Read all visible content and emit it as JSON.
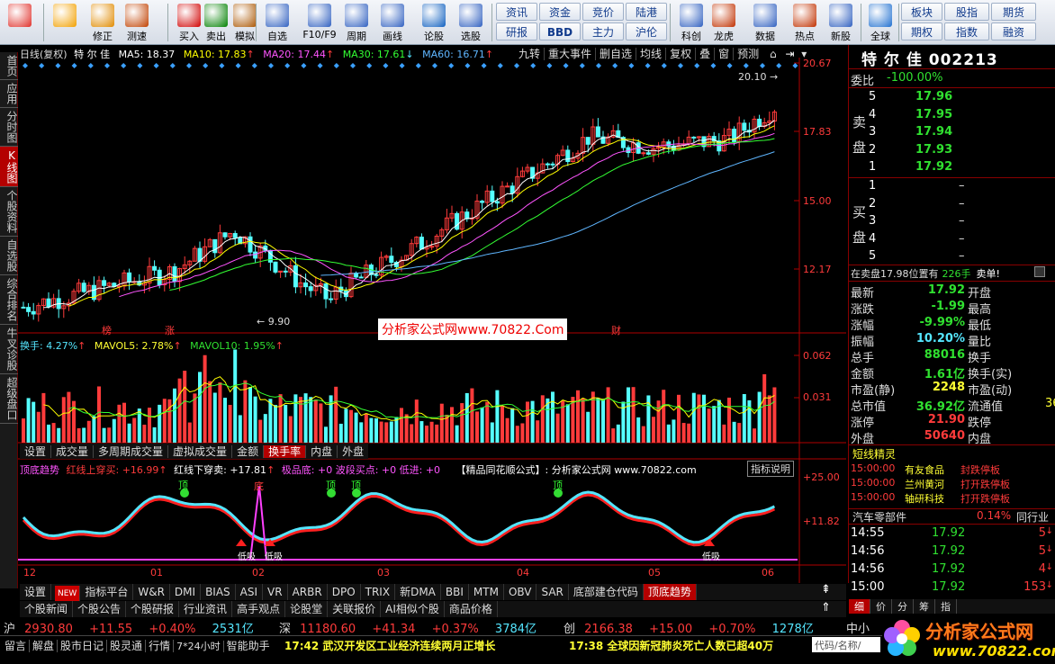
{
  "toolbar": {
    "buttons": [
      {
        "label": "",
        "icon": "grid-icon",
        "color": "#e0302a"
      },
      {
        "label": "",
        "icon": "back-arrow-icon",
        "color": "#f2a000"
      },
      {
        "label": "修正",
        "icon": "repair-icon",
        "color": "#e08a00"
      },
      {
        "label": "测速",
        "icon": "clock-icon",
        "color": "#c04000"
      },
      {
        "label": "买入",
        "icon": "buy-icon",
        "color": "#d00000"
      },
      {
        "label": "卖出",
        "icon": "sell-icon",
        "color": "#008000"
      },
      {
        "label": "模拟",
        "icon": "hammer-icon",
        "color": "#aa5500"
      },
      {
        "label": "自选",
        "icon": "star-icon",
        "color": "#3060c0"
      },
      {
        "label": "F10/F9",
        "icon": "f10-icon",
        "color": "#3060c0"
      },
      {
        "label": "周期",
        "icon": "period-icon",
        "color": "#3060c0"
      },
      {
        "label": "画线",
        "icon": "pen-icon",
        "color": "#3060c0"
      },
      {
        "label": "论股",
        "icon": "discuss-icon",
        "color": "#1060c0"
      },
      {
        "label": "选股",
        "icon": "pick-icon",
        "color": "#3060c0"
      },
      {
        "label": "科创",
        "icon": "sci-icon",
        "color": "#3060c0"
      },
      {
        "label": "龙虎",
        "icon": "dragon-icon",
        "color": "#c03000"
      },
      {
        "label": "数据",
        "icon": "data-icon",
        "color": "#3060c0"
      },
      {
        "label": "热点",
        "icon": "hot-icon",
        "color": "#c03000"
      },
      {
        "label": "新股",
        "icon": "ipo-icon",
        "color": "#3060c0"
      },
      {
        "label": "全球",
        "icon": "globe-icon",
        "color": "#2070d0"
      }
    ],
    "text_buttons": [
      "资讯",
      "资金",
      "竞价",
      "陆港",
      "研报",
      "BBD",
      "主力",
      "沪伦",
      "板块",
      "股指",
      "指数",
      "期货",
      "期权",
      "融资"
    ]
  },
  "left_tabs": [
    "首页",
    "应用",
    "分时图",
    "K线图",
    "个股资料",
    "自选股",
    "综合排名",
    "牛叉诊股",
    "超级盘口"
  ],
  "chart_header": {
    "period": "日线(复权)",
    "name": "特 尔 佳",
    "ma5": "MA5: 18.37",
    "ma10": "MA10: 17.83",
    "ma20": "MA20: 17.44",
    "ma30": "MA30: 17.61",
    "ma60": "MA60: 16.71",
    "buttons": [
      "九转",
      "重大事件",
      "删自选",
      "均线",
      "复权",
      "叠",
      "窗",
      "预测"
    ]
  },
  "price_axis": [
    "20.67",
    "17.83",
    "15.00",
    "12.17"
  ],
  "annotations": {
    "high": "20.10",
    "low": "9.90",
    "markers": [
      "榜",
      "涨",
      "财"
    ]
  },
  "watermark": "分析家公式网www.70822.Com",
  "vol_header": {
    "turnover": "换手: 4.27%",
    "mavol5": "MAVOL5: 2.78%",
    "mavol10": "MAVOL10: 1.95%"
  },
  "vol_axis": [
    "0.062",
    "0.031"
  ],
  "mid_tabs": [
    "设置",
    "成交量",
    "多周期成交量",
    "虚拟成交量",
    "金额",
    "换手率",
    "内盘",
    "外盘"
  ],
  "ind_header": {
    "name": "顶底趋势",
    "red": "红线上穿买: +16.99",
    "green": "红线下穿卖: +17.81",
    "bottom": "极品底: +0",
    "wave": "波段买点: +0",
    "low": "低进: +0",
    "source": "【精品同花顺公式】: 分析家公式网 www.70822.com",
    "explain": "指标说明",
    "labels": [
      "顶",
      "顶",
      "顶",
      "顶",
      "底",
      "低吸",
      "低吸",
      "低吸"
    ]
  },
  "ind_axis": [
    "+25.00",
    "+11.82"
  ],
  "x_axis": [
    "12",
    "01",
    "02",
    "03",
    "04",
    "05",
    "06"
  ],
  "bottom_tabs": [
    "设置",
    "指标平台",
    "W&R",
    "DMI",
    "BIAS",
    "ASI",
    "VR",
    "ARBR",
    "DPO",
    "TRIX",
    "新DMA",
    "BBI",
    "MTM",
    "OBV",
    "SAR",
    "底部建仓代码",
    "顶底趋势"
  ],
  "new_badge": "NEW",
  "bottom_tabs2": [
    "个股新闻",
    "个股公告",
    "个股研报",
    "行业资讯",
    "高手观点",
    "论股堂",
    "关联报价",
    "AI相似个股",
    "商品价格"
  ],
  "quote": {
    "title": "特 尔 佳 002213",
    "weibi_label": "委比",
    "weibi": "-100.00%",
    "sell_label": [
      "卖",
      "盘"
    ],
    "buy_label": [
      "买",
      "盘"
    ],
    "sell": [
      {
        "n": "5",
        "p": "17.96"
      },
      {
        "n": "4",
        "p": "17.95"
      },
      {
        "n": "3",
        "p": "17.94"
      },
      {
        "n": "2",
        "p": "17.93"
      },
      {
        "n": "1",
        "p": "17.92"
      }
    ],
    "buy": [
      {
        "n": "1",
        "p": "–"
      },
      {
        "n": "2",
        "p": "–"
      },
      {
        "n": "3",
        "p": "–"
      },
      {
        "n": "4",
        "p": "–"
      },
      {
        "n": "5",
        "p": "–"
      }
    ],
    "zaimai": "在卖盘17.98位置有",
    "zaimai_vol": "226手",
    "zaimai_tag": "卖单!",
    "stats": [
      {
        "k": "最新",
        "v": "17.92",
        "k2": "开盘",
        "v2": ""
      },
      {
        "k": "涨跌",
        "v": "-1.99",
        "k2": "最高",
        "v2": ""
      },
      {
        "k": "涨幅",
        "v": "-9.99%",
        "k2": "最低",
        "v2": ""
      },
      {
        "k": "振幅",
        "v": "10.20%",
        "k2": "量比",
        "v2": ""
      },
      {
        "k": "总手",
        "v": "88016",
        "k2": "换手",
        "v2": ""
      },
      {
        "k": "金额",
        "v": "1.61亿",
        "k2": "换手(实)",
        "v2": ""
      },
      {
        "k": "市盈(静)",
        "v": "2248",
        "k2": "市盈(动)",
        "v2": ""
      },
      {
        "k": "总市值",
        "v": "36.92亿",
        "k2": "流通值",
        "v2": "36"
      },
      {
        "k": "涨停",
        "v": "21.90",
        "k2": "跌停",
        "v2": ""
      },
      {
        "k": "外盘",
        "v": "50640",
        "k2": "内盘",
        "v2": ""
      }
    ],
    "sprite_title": "短线精灵",
    "sprites": [
      {
        "t": "15:00:00",
        "name": "有友食品",
        "act": "封跌停板"
      },
      {
        "t": "15:00:00",
        "name": "兰州黄河",
        "act": "打开跌停板"
      },
      {
        "t": "15:00:00",
        "name": "轴研科技",
        "act": "打开跌停板"
      }
    ],
    "sector": "汽车零部件",
    "sector_pct": "0.14%",
    "sector_tag": "同行业",
    "ticks": [
      {
        "t": "14:55",
        "p": "17.92",
        "v": "5"
      },
      {
        "t": "14:56",
        "p": "17.92",
        "v": "5"
      },
      {
        "t": "14:56",
        "p": "17.92",
        "v": "4"
      },
      {
        "t": "15:00",
        "p": "17.92",
        "v": "153"
      }
    ],
    "tick_tabs": [
      "细",
      "价",
      "分",
      "筹",
      "指"
    ]
  },
  "index_bar": [
    {
      "name": "沪",
      "v": "2930.80",
      "c": "+11.55",
      "p": "+0.40%",
      "amt": "2531亿"
    },
    {
      "name": "深",
      "v": "11180.60",
      "c": "+41.34",
      "p": "+0.37%",
      "amt": "3784亿"
    },
    {
      "name": "创",
      "v": "2166.38",
      "c": "+15.00",
      "p": "+0.70%",
      "amt": "1278亿"
    }
  ],
  "index_tail": "中小",
  "news_left": [
    "留言",
    "解盘",
    "股市日记",
    "股灵通",
    "行情",
    "7*24小时",
    "智能助手"
  ],
  "news": [
    {
      "t": "17:42",
      "text": "武汉开发区工业经济连续两月正增长"
    },
    {
      "t": "17:38",
      "text": "全球因新冠肺炎死亡人数已超40万"
    }
  ],
  "code_input": "代码/名称/",
  "logo": {
    "text": "分析家公式网",
    "url": "www.70822.com"
  },
  "colors": {
    "up": "#ff3b3b",
    "down": "#55ffff",
    "ma5": "#ffffff",
    "ma10": "#ffff00",
    "ma20": "#ff55ff",
    "ma30": "#33ff33",
    "ma60": "#5fb6ff"
  }
}
